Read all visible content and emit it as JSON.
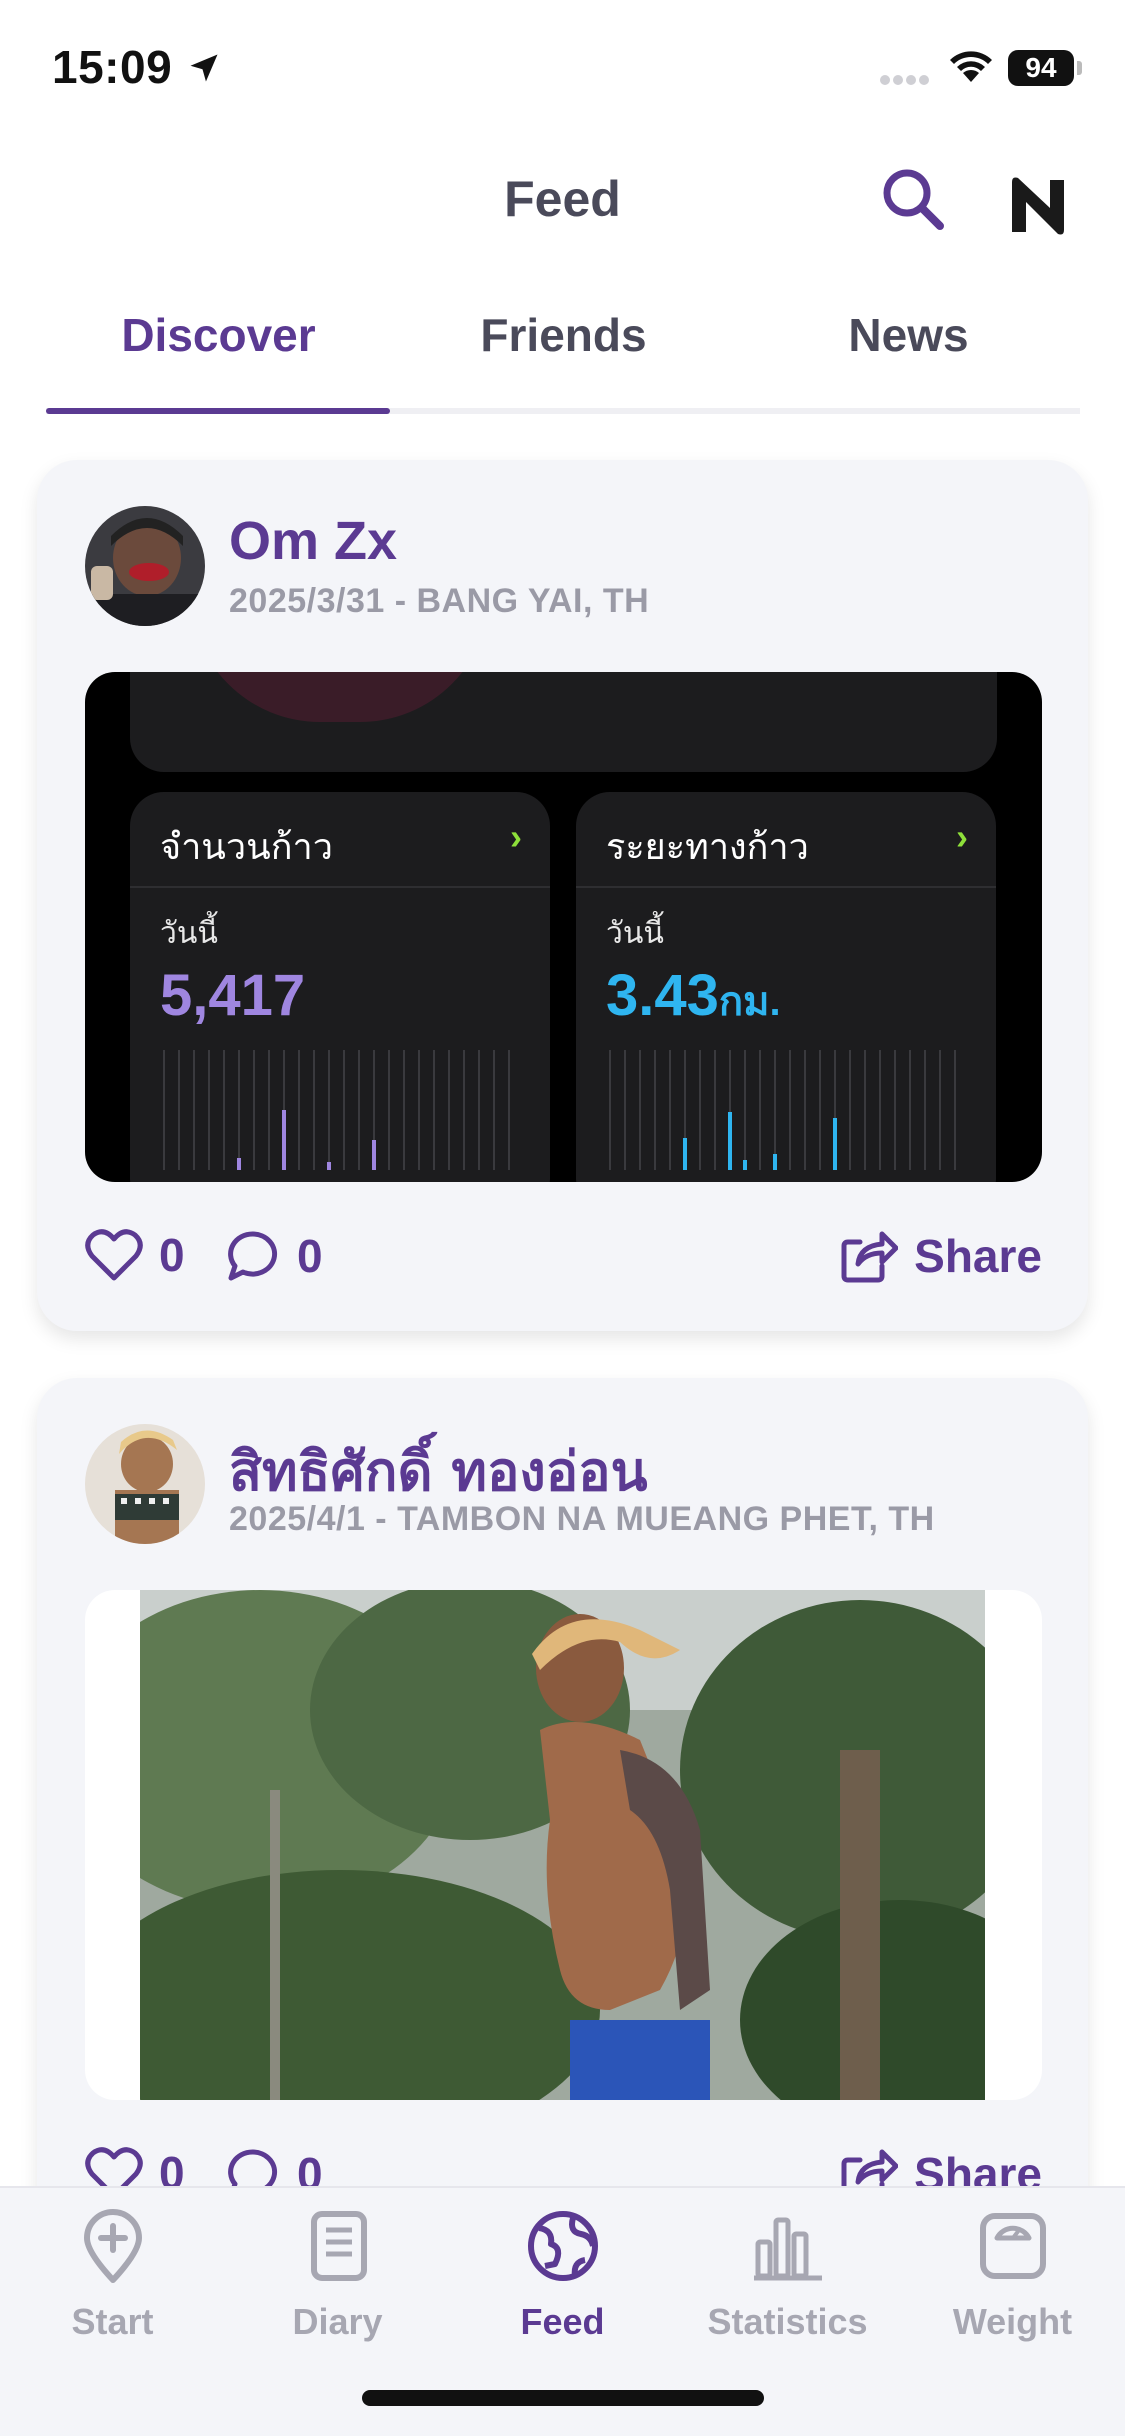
{
  "status_bar": {
    "time": "15:09",
    "battery": "94"
  },
  "header": {
    "title": "Feed"
  },
  "tabs": [
    {
      "label": "Discover",
      "active": true
    },
    {
      "label": "Friends",
      "active": false
    },
    {
      "label": "News",
      "active": false
    }
  ],
  "posts": [
    {
      "user": "Om Zx",
      "meta": "2025/3/31 - BANG YAI, TH",
      "likes": "0",
      "comments": "0",
      "share_label": "Share",
      "media": {
        "tiles": [
          {
            "title": "จำนวนก้าว",
            "sub": "วันนี้",
            "value": "5,417",
            "unit": "",
            "color": "#9f86e0"
          },
          {
            "title": "ระยะทางก้าว",
            "sub": "วันนี้",
            "value": "3.43",
            "unit": "กม.",
            "color": "#2fb5f0"
          }
        ]
      }
    },
    {
      "user": "สิทธิศักดิ์ ทองอ่อน",
      "meta": "2025/4/1 - TAMBON NA MUEANG PHET, TH",
      "likes": "0",
      "comments": "0",
      "share_label": "Share"
    }
  ],
  "nav": [
    {
      "label": "Start",
      "icon": "pin-plus-icon",
      "active": false
    },
    {
      "label": "Diary",
      "icon": "diary-icon",
      "active": false
    },
    {
      "label": "Feed",
      "icon": "globe-icon",
      "active": true
    },
    {
      "label": "Statistics",
      "icon": "bar-chart-icon",
      "active": false
    },
    {
      "label": "Weight",
      "icon": "scale-icon",
      "active": false
    }
  ],
  "colors": {
    "accent": "#5b3a92",
    "inactive": "#a7a7b2",
    "card_bg": "#f4f5f9"
  }
}
